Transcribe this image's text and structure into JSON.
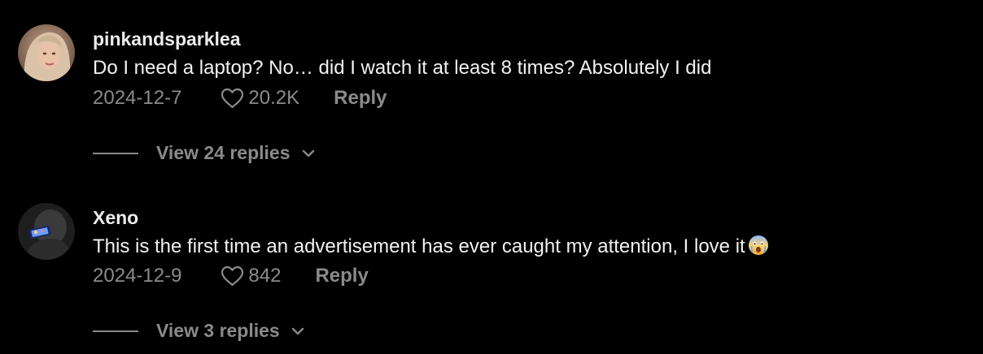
{
  "comments": [
    {
      "username": "pinkandsparklea",
      "text": "Do I need a laptop? No… did I watch it at least 8 times? Absolutely I did",
      "date": "2024-12-7",
      "likes": "20.2K",
      "reply_label": "Reply",
      "view_replies_label": "View 24 replies",
      "avatar": "user-avatar-photo"
    },
    {
      "username": "Xeno",
      "text": "This is the first time an advertisement has ever caught my attention, I love it",
      "emoji": "crying-face-emoji",
      "date": "2024-12-9",
      "likes": "842",
      "reply_label": "Reply",
      "view_replies_label": "View 3 replies",
      "avatar": "user-avatar-photo"
    }
  ],
  "icons": {
    "like": "heart-outline-icon",
    "expand": "chevron-down-icon"
  },
  "colors": {
    "background": "#000000",
    "username": "#ececec",
    "text": "#f2f2f2",
    "secondary": "#8a8a8a"
  }
}
